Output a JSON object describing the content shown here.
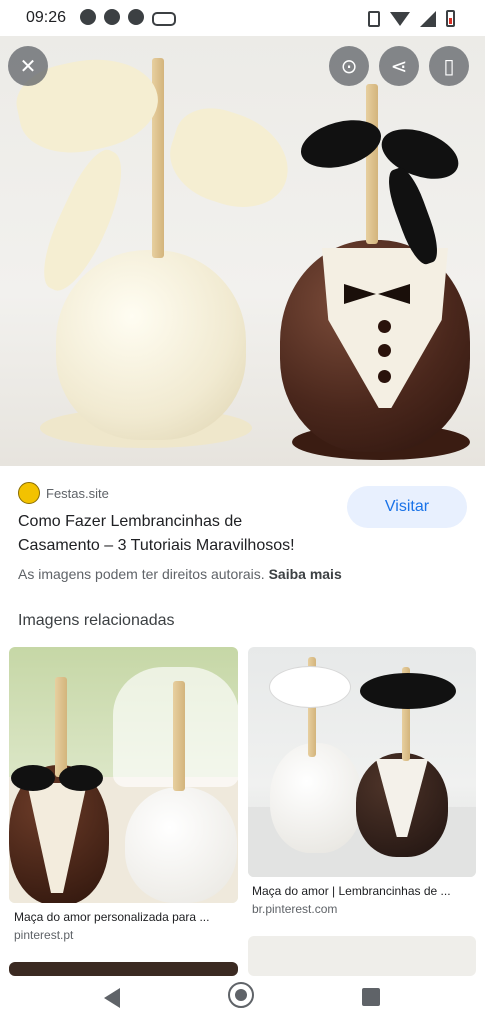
{
  "status_bar": {
    "time": "09:26",
    "left_icons": [
      "chrome-icon",
      "chrome-icon",
      "mail-icon",
      "voicemail-icon"
    ],
    "right_icons": [
      "vibrate-icon",
      "wifi-icon",
      "signal-icon",
      "battery-icon"
    ]
  },
  "viewer": {
    "buttons": [
      "close-icon",
      "lens-icon",
      "share-icon",
      "bookmark-icon"
    ]
  },
  "source": {
    "name": "Festas.site",
    "title": "Como Fazer Lembrancinhas de Casamento – 3 Tutoriais Maravilhosos!",
    "visit_label": "Visitar"
  },
  "rights": {
    "text": "As imagens podem ter direitos autorais.",
    "link": "Saiba mais"
  },
  "related": {
    "heading": "Imagens relacionadas",
    "items": [
      {
        "caption": "Maça do amor personalizada para ...",
        "domain": "pinterest.pt"
      },
      {
        "caption": "Maça do amor | Lembrancinhas de ...",
        "domain": "br.pinterest.com"
      }
    ]
  },
  "colors": {
    "accent": "#1a73e8",
    "visit_bg": "#e8f0fe",
    "text_primary": "#202124",
    "text_secondary": "#5f6368"
  }
}
